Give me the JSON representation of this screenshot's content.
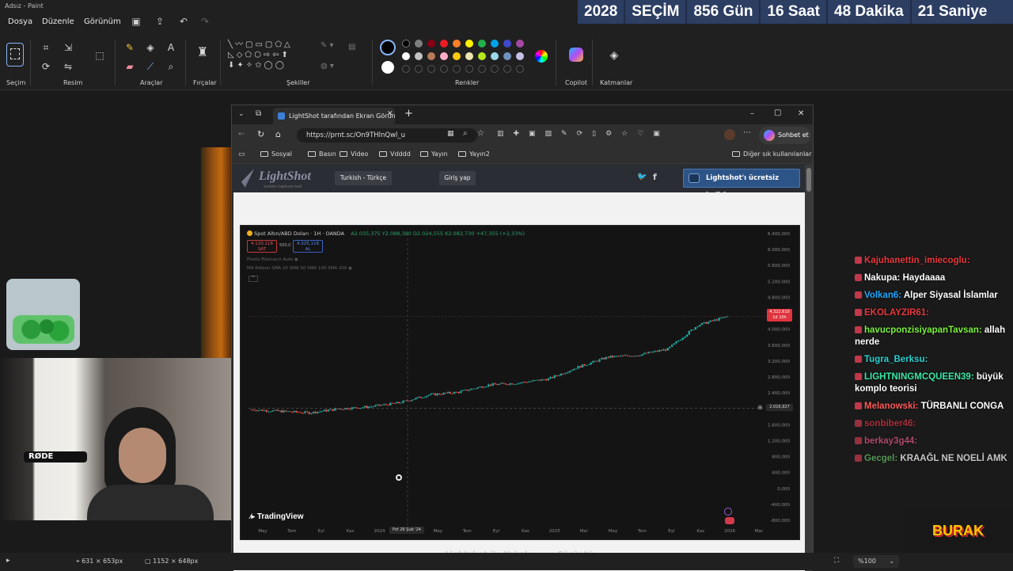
{
  "paint": {
    "title": "Adsız - Paint",
    "menu": [
      "Dosya",
      "Düzenle",
      "Görünüm"
    ],
    "ribbon_groups": [
      "Seçim",
      "Resim",
      "Araçlar",
      "Fırçalar",
      "Şekiller",
      "Renkler",
      "Copilot",
      "Katmanlar"
    ],
    "palette": [
      "#000000",
      "#7f7f7f",
      "#880015",
      "#ed1c24",
      "#ff7f27",
      "#fff200",
      "#22b14c",
      "#00a2e8",
      "#3f48cc",
      "#a349a4",
      "#ffffff",
      "#c3c3c3",
      "#b97a57",
      "#ffaec9",
      "#ffc90e",
      "#efe4b0",
      "#b5e61d",
      "#99d9ea",
      "#7092be",
      "#c8bfe7"
    ],
    "status": {
      "cursor_pos": "631 × 653px",
      "canvas_size": "1152 × 648px",
      "zoom": "%100"
    }
  },
  "countdown": [
    "2028",
    "SEÇİM",
    "856 Gün",
    "16 Saat",
    "48 Dakika",
    "21 Saniye"
  ],
  "browser": {
    "tab_title": "LightShot tarafından Ekran Görünt",
    "url": "https://prnt.sc/On9THlnQwl_u",
    "copilot_button": "Sohbet et",
    "bookmarks": [
      "Sosyal",
      "Basın",
      "Video",
      "Vdddd",
      "Yayın",
      "Yayın2"
    ],
    "other_bookmarks": "Diğer sık kullanılanlar"
  },
  "lightshot": {
    "logo": "LightShot",
    "logo_sub": "screen capture tool",
    "language": "Turkish - Türkçe",
    "login": "Giriş yap",
    "download": "Lightshot'ı ücretsiz indirin",
    "footer": "Lightshot ile Yakalanmış Görüntü"
  },
  "tradingview": {
    "symbol": "Spot Altın/ABD Doları · 1H · OANDA",
    "ohlc": "A2.035,375 Y2.088,380 D2.024,555 K2.082,730 +47,355 (+2,33%)",
    "sell_label": "SAT",
    "sell_price": "4.120,118",
    "spread": "500,0",
    "buy_label": "AL",
    "buy_price": "4.325,118",
    "indicator1": "Pivots Fibonacci Auto",
    "indicator2": "MA Ribbon SMA 20 SMA 50 SMA 100 SMA 200",
    "logo": "TradingView",
    "last_price_tag": "4.322,610",
    "last_price_time": "1d 10h",
    "crosshair_tag": "2.016,927",
    "crosshair_date": "Pzt 26 Şub '24",
    "y_ticks": [
      "6.400,000",
      "6.000,000",
      "5.600,000",
      "5.200,000",
      "4.800,000",
      "4.400,000",
      "4.000,000",
      "3.600,000",
      "3.200,000",
      "2.800,000",
      "2.400,000",
      "2.000,000",
      "1.600,000",
      "1.200,000",
      "800,000",
      "400,000",
      "0,000",
      "-400,000",
      "-800,000"
    ],
    "x_ticks": [
      "May",
      "Tem",
      "Eyl",
      "Kas",
      "2024",
      "Mar",
      "May",
      "Tem",
      "Eyl",
      "Kas",
      "2025",
      "Mar",
      "May",
      "Tem",
      "Eyl",
      "Kas",
      "2026",
      "Mar"
    ]
  },
  "chart_data": {
    "type": "line",
    "title": "Spot Altın/ABD Doları · 1H · OANDA",
    "xlabel": "",
    "ylabel": "",
    "ylim": [
      -800,
      6400
    ],
    "x": [
      "2023-05",
      "2023-07",
      "2023-09",
      "2023-11",
      "2024-01",
      "2024-03",
      "2024-05",
      "2024-07",
      "2024-09",
      "2024-11",
      "2025-01",
      "2025-03",
      "2025-05",
      "2025-07",
      "2025-09",
      "2025-11",
      "2026-01"
    ],
    "series": [
      {
        "values": [
          1980,
          1940,
          1900,
          2000,
          2050,
          2150,
          2350,
          2420,
          2600,
          2650,
          2750,
          3050,
          3300,
          3350,
          3500,
          4100,
          4320
        ]
      }
    ]
  },
  "chat": [
    {
      "user": "Kajuhanettin_imiecoglu",
      "msg": "",
      "color": "#e8383d"
    },
    {
      "user": "Nakupa",
      "msg": "Haydaaaa",
      "color": "#ffffff"
    },
    {
      "user": "Volkan6",
      "msg": "Alper Siyasal İslamlar",
      "color": "#1fa7ff"
    },
    {
      "user": "EKOLAYZIR61",
      "msg": "",
      "color": "#e8383d"
    },
    {
      "user": "havucponzisiyapanTavsan",
      "msg": "allah nerde",
      "color": "#7cf03a"
    },
    {
      "user": "Tugra_Berksu",
      "msg": "",
      "color": "#2bd1d1"
    },
    {
      "user": "LIGHTNINGMCQUEEN39",
      "msg": "büyük komplo teorisi",
      "color": "#39e6a8"
    },
    {
      "user": "Melanowski",
      "msg": "TÜRBANLI CONGA",
      "color": "#ff5a5a"
    },
    {
      "user": "sonbiber46",
      "msg": "",
      "color": "#d9384a"
    },
    {
      "user": "berkay3g44",
      "msg": "",
      "color": "#e05a8a"
    },
    {
      "user": "Gecgel",
      "msg": "KRAAĞL NE NOELİ AMK",
      "color": "#6ec46e"
    }
  ],
  "webcam": {
    "mic_brand": "RØDE"
  },
  "overlay": {
    "streamer": "BURAK"
  }
}
